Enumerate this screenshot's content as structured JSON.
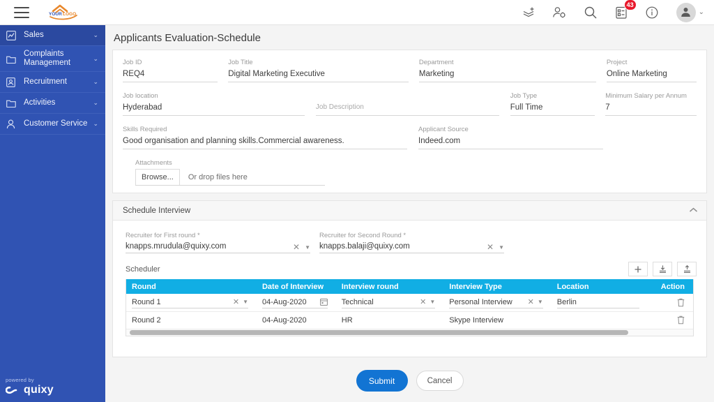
{
  "topbar": {
    "menu_icon": "hamburger-icon",
    "logo_text": "YOUR LOGO",
    "icons": [
      {
        "name": "add-layers-icon",
        "label": "Add"
      },
      {
        "name": "user-settings-icon",
        "label": "User Settings"
      },
      {
        "name": "search-icon",
        "label": "Search"
      },
      {
        "name": "tasks-icon",
        "label": "Tasks",
        "badge": "43"
      },
      {
        "name": "info-icon",
        "label": "Info"
      }
    ],
    "avatar_caret": "⌄"
  },
  "sidebar": {
    "items": [
      {
        "label": "Sales",
        "icon": "chart-icon",
        "active": true,
        "chevron": "⌄"
      },
      {
        "label": "Complaints Management",
        "icon": "folder-icon",
        "active": false,
        "chevron": "⌄"
      },
      {
        "label": "Recruitment",
        "icon": "id-card-icon",
        "active": false,
        "chevron": "⌄"
      },
      {
        "label": "Activities",
        "icon": "folder-icon",
        "active": false,
        "chevron": "⌄"
      },
      {
        "label": "Customer Service",
        "icon": "person-icon",
        "active": false,
        "chevron": "⌄"
      }
    ],
    "footer": {
      "powered_by": "powered by",
      "brand": "quixy"
    }
  },
  "page": {
    "title": "Applicants Evaluation-Schedule"
  },
  "job_form": {
    "job_id": {
      "label": "Job ID",
      "value": "REQ4"
    },
    "job_title": {
      "label": "Job Title",
      "value": "Digital Marketing Executive"
    },
    "department": {
      "label": "Department",
      "value": "Marketing"
    },
    "project": {
      "label": "Project",
      "value": "Online Marketing"
    },
    "job_location": {
      "label": "Job location",
      "value": "Hyderabad"
    },
    "job_description": {
      "label": "Job Description",
      "value": ""
    },
    "job_type": {
      "label": "Job Type",
      "value": "Full Time"
    },
    "min_salary": {
      "label": "Minimum Salary per Annum",
      "value": "7"
    },
    "skills_required": {
      "label": "Skills Required",
      "value": "Good organisation and planning skills.Commercial awareness."
    },
    "applicant_source": {
      "label": "Applicant Source",
      "value": "Indeed.com"
    },
    "attachments": {
      "label": "Attachments",
      "browse_label": "Browse...",
      "drop_text": "Or drop files here"
    }
  },
  "schedule_section": {
    "title": "Schedule Interview",
    "collapse_icon": "chevron-up-icon",
    "recruiter_first": {
      "label": "Recruiter for First round",
      "required": "*",
      "value": "knapps.mrudula@quixy.com"
    },
    "recruiter_second": {
      "label": "Recruiter for Second Round",
      "required": "*",
      "value": "knapps.balaji@quixy.com"
    },
    "scheduler": {
      "label": "Scheduler",
      "toolbar": [
        {
          "name": "add-row-button",
          "glyph": "+"
        },
        {
          "name": "import-button",
          "glyph": "download"
        },
        {
          "name": "export-button",
          "glyph": "upload"
        }
      ],
      "columns": [
        "Round",
        "Date of Interview",
        "Interview round",
        "Interview Type",
        "Location",
        "Action"
      ],
      "rows": [
        {
          "editable": true,
          "round": "Round 1",
          "date": "04-Aug-2020",
          "interview_round": "Technical",
          "interview_type": "Personal Interview",
          "location": "Berlin",
          "action": "delete-icon"
        },
        {
          "editable": false,
          "round": "Round 2",
          "date": "04-Aug-2020",
          "interview_round": "HR",
          "interview_type": "Skype Interview",
          "location": "",
          "action": "delete-icon"
        }
      ]
    }
  },
  "footer_actions": {
    "submit": "Submit",
    "cancel": "Cancel"
  },
  "colors": {
    "sidebar": "#3053b3",
    "sidebar_active": "#2b49a0",
    "table_header": "#11aee4",
    "submit": "#1274d3",
    "badge": "#e8192c",
    "logo_orange": "#e8872b"
  }
}
